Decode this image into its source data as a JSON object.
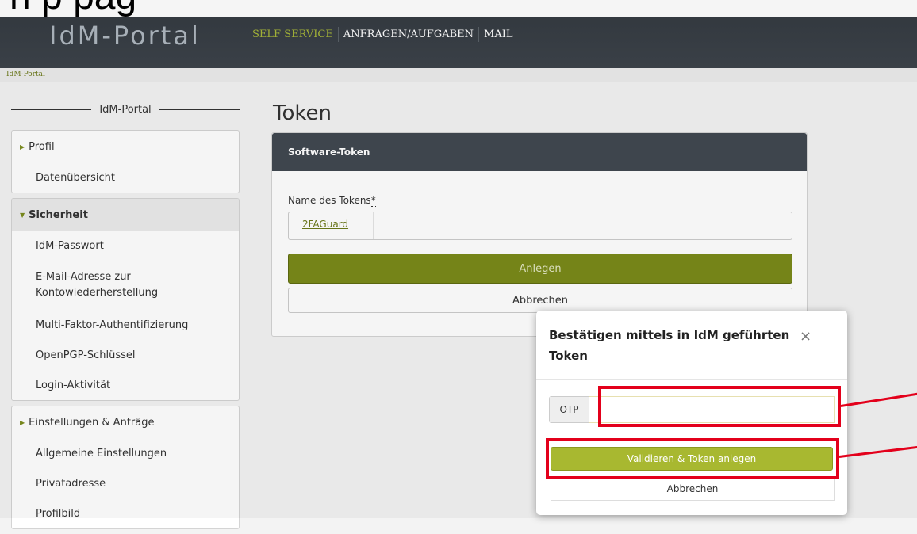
{
  "app": {
    "logo": "IdM-Portal",
    "nav": [
      "SELF SERVICE",
      "ANFRAGEN/AUFGABEN",
      "MAIL"
    ],
    "breadcrumb": "IdM-Portal",
    "caption_partial": "n   p                   pag"
  },
  "sidebar": {
    "heading": "IdM-Portal",
    "groups": [
      {
        "label": "Profil",
        "items": [
          "Datenübersicht"
        ]
      },
      {
        "label": "Sicherheit",
        "items": [
          "IdM-Passwort",
          "E-Mail-Adresse zur Kontowiederherstellung",
          "Multi-Faktor-Authentifizierung",
          "OpenPGP-Schlüssel",
          "Login-Aktivität"
        ]
      },
      {
        "label": "Einstellungen & Anträge",
        "items": [
          "Allgemeine Einstellungen",
          "Privatadresse",
          "Profilbild"
        ]
      }
    ]
  },
  "main": {
    "title": "Token",
    "card": {
      "header": "Software-Token",
      "field_label": "Name des Tokens",
      "required_mark": "*",
      "field_value": "2FAGuard",
      "create_label": "Anlegen",
      "cancel_label": "Abbrechen"
    }
  },
  "modal": {
    "title": "Bestätigen mittels in IdM geführten Token",
    "close_glyph": "×",
    "otp_label": "OTP",
    "otp_value": "",
    "validate_label": "Validieren & Token anlegen",
    "cancel_label": "Abbrechen"
  },
  "colors": {
    "accent": "#a8b830",
    "accent_dark": "#7a8a1a",
    "header_bg": "#3a4047",
    "highlight": "#e3001b"
  }
}
